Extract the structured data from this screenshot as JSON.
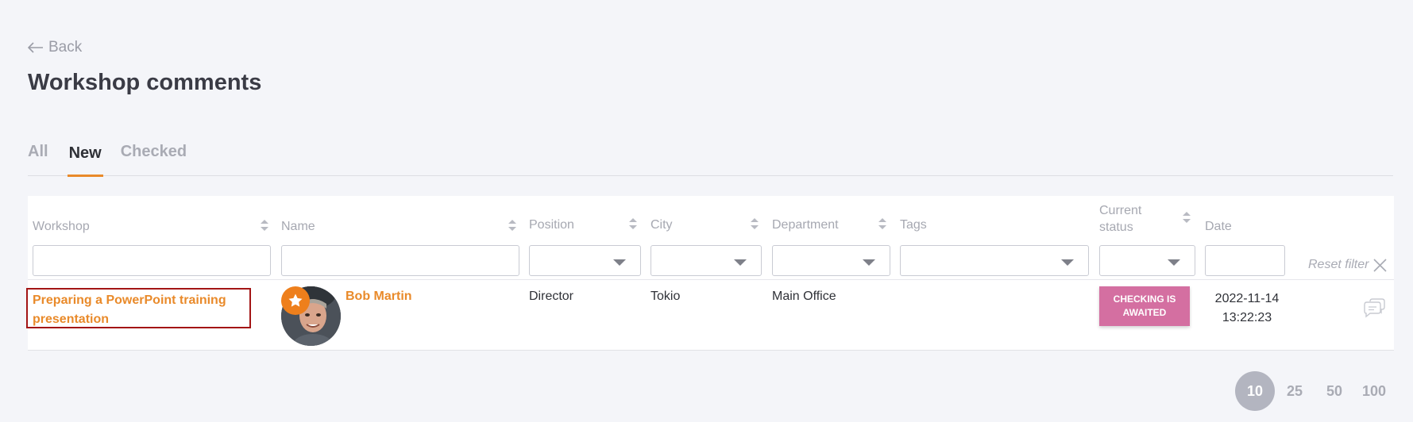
{
  "nav": {
    "back_label": "Back"
  },
  "page": {
    "title": "Workshop comments"
  },
  "tabs": [
    {
      "label": "All",
      "active": false
    },
    {
      "label": "New",
      "active": true
    },
    {
      "label": "Checked",
      "active": false
    }
  ],
  "table": {
    "columns": [
      {
        "label": "Workshop",
        "sortable": true
      },
      {
        "label": "Name",
        "sortable": true
      },
      {
        "label": "Position",
        "sortable": true
      },
      {
        "label": "City",
        "sortable": true
      },
      {
        "label": "Department",
        "sortable": true
      },
      {
        "label": "Tags",
        "sortable": false
      },
      {
        "label": "Current status",
        "sortable": true
      },
      {
        "label": "Date",
        "sortable": false
      }
    ],
    "reset_filter_label": "Reset filter",
    "rows": [
      {
        "workshop": "Preparing a PowerPoint training presentation",
        "name": "Bob Martin",
        "position": "Director",
        "city": "Tokio",
        "department": "Main Office",
        "tags": "",
        "status": "CHECKING IS AWAITED",
        "date": "2022-11-14",
        "time": "13:22:23"
      }
    ]
  },
  "pagination": {
    "options": [
      "10",
      "25",
      "50",
      "100"
    ],
    "selected": "10"
  },
  "colors": {
    "accent": "#e98a2a",
    "status_awaited": "#d46fa1",
    "highlight_border": "#a31515",
    "background": "#f4f5f9"
  },
  "icons": [
    "arrow-left-icon",
    "sort-icon",
    "chevron-down-icon",
    "close-icon",
    "star-icon",
    "comment-icon"
  ]
}
